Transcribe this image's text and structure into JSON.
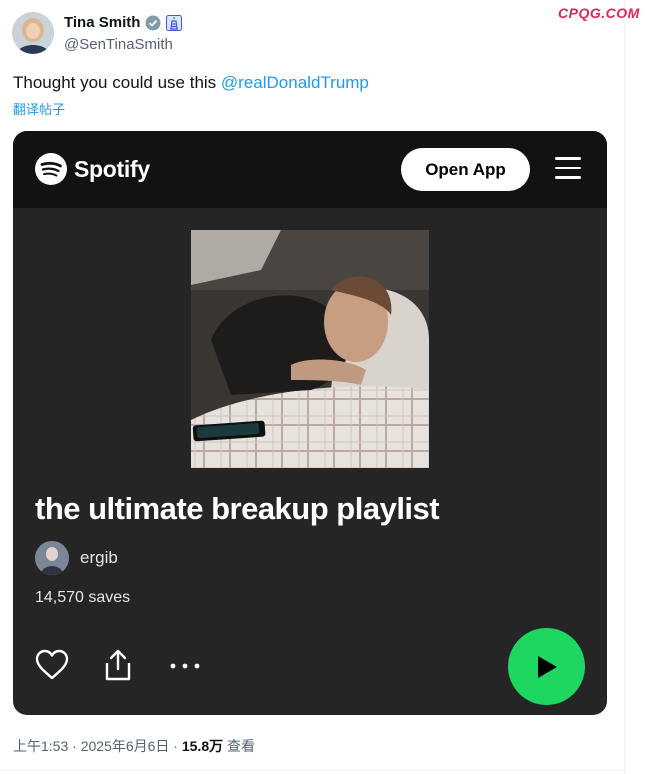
{
  "watermark": "CPQG.COM",
  "tweet": {
    "author_name": "Tina Smith",
    "author_handle": "@SenTinaSmith",
    "text_prefix": "Thought you could use this ",
    "mention": "@realDonaldTrump",
    "translate_label": "翻译帖子"
  },
  "card": {
    "brand": "Spotify",
    "open_app_label": "Open App",
    "playlist_title": "the ultimate breakup playlist",
    "owner_name": "ergib",
    "saves": "14,570 saves"
  },
  "meta": {
    "time_date": "上午1:53 · 2025年6月6日 · ",
    "views": "15.8万",
    "views_label": " 查看"
  },
  "colors": {
    "link": "#1d9bf0",
    "spotify_green": "#1ed760",
    "card_bg": "#252525"
  },
  "icons": [
    "verified-badge-icon",
    "gov-badge-icon",
    "spotify-logo-icon",
    "hamburger-menu-icon",
    "heart-icon",
    "share-icon",
    "more-icon",
    "play-icon"
  ]
}
